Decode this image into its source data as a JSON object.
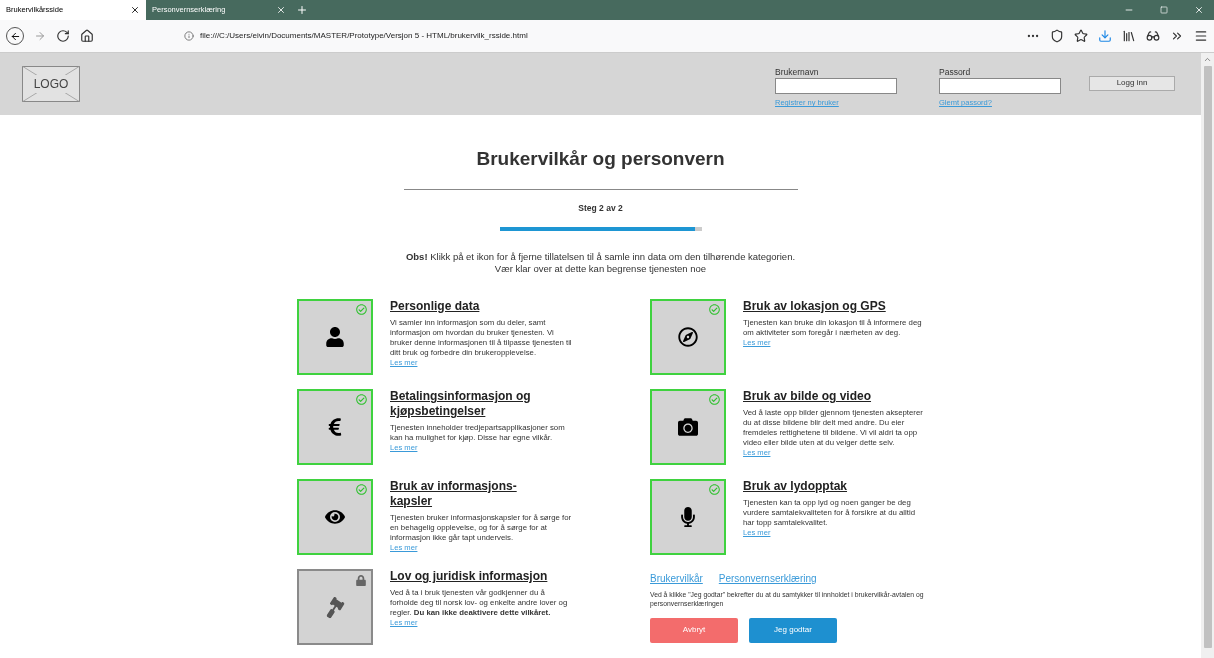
{
  "browser": {
    "tabs": [
      {
        "label": "Brukervilkårsside",
        "selected": true
      },
      {
        "label": "Personvernserklæring",
        "selected": false
      }
    ],
    "address": "file:///C:/Users/eivin/Documents/MASTER/Prototype/Versjon 5 - HTML/brukervilk_rsside.html"
  },
  "header": {
    "logo": "LOGO",
    "username_label": "Brukernavn",
    "password_label": "Passord",
    "register_link": "Registrer ny bruker",
    "forgot_link": "Glemt passord?",
    "login_button": "Logg inn"
  },
  "page": {
    "title": "Brukervilkår og personvern",
    "step": "Steg 2 av 2",
    "progress": {
      "level": 0.97
    },
    "notice": [
      "**Obs!** Klikk på et ikon for å fjerne tillatelsen til å samle inn data om den tilhørende kategorien.",
      "Vær klar over at dette kan begrense tjenesten noe"
    ]
  },
  "categories": [
    {
      "kind": "toggle",
      "allowed": true,
      "title": "Personlige data",
      "text": "Vi samler inn informasjon som du deler, samt informasjon om hvordan du bruker tjenesten. Vi bruker denne informasjonen til å tilpasse tjenesten til ditt bruk og forbedre din brukeropplevelse.",
      "link": "Les mer"
    },
    {
      "kind": "toggle",
      "allowed": true,
      "title": "Bruk av lokasjon og GPS",
      "text": "Tjenesten kan bruke din lokasjon til å informere deg om aktiviteter som foregår i nærheten av deg.",
      "link": "Les mer"
    },
    {
      "kind": "toggle",
      "allowed": true,
      "title": "Betalingsinformasjon og kjøpsbetingelser",
      "text": "Tjenesten inneholder tredjepartsapplikasjoner som kan ha mulighet for kjøp. Disse har egne vilkår.",
      "link": "Les mer"
    },
    {
      "kind": "toggle",
      "allowed": true,
      "title": "Bruk av bilde og video",
      "text": "Ved å laste opp bilder gjennom tjenesten aksepterer du at disse bildene blir delt med andre. Du eier fremdeles rettighetene til bildene. Vi vil aldri ta opp video eller bilde uten at du  velger dette selv.",
      "link": "Les mer"
    },
    {
      "kind": "toggle",
      "allowed": true,
      "title": "Bruk av informasjons-kapsler",
      "text": "Tjenesten bruker informasjonskapsler for å sørge for en behagelig opplevelse, og for å sørge for at informasjon ikke går tapt underveis.",
      "link": "Les mer"
    },
    {
      "kind": "toggle",
      "allowed": true,
      "title": "Bruk av lydopptak",
      "text": "Tjenesten kan ta opp lyd og noen ganger be deg vurdere samtalekvaliteten for å forsikre at du alltid har topp samtalekvalitet.",
      "link": "Les mer"
    },
    {
      "kind": "locked",
      "title": "Lov og juridisk informasjon",
      "text": "Ved å ta i bruk tjenesten vår godkjenner du å forholde deg til norsk lov- og enkelte andre lover og regler. **Du kan ikke deaktivere dette vilkåret.**",
      "link": "Les mer"
    }
  ],
  "consent": {
    "links": [
      "Brukervilkår",
      "Personvernserklæring"
    ],
    "text": "Ved å klikke \"Jeg godtar\" bekrefter du at du samtykker til innholdet i brukervilkår-avtalen og personvernserklæringen",
    "cancel_button": "Avbryt",
    "accept_button": "Jeg godtar"
  }
}
